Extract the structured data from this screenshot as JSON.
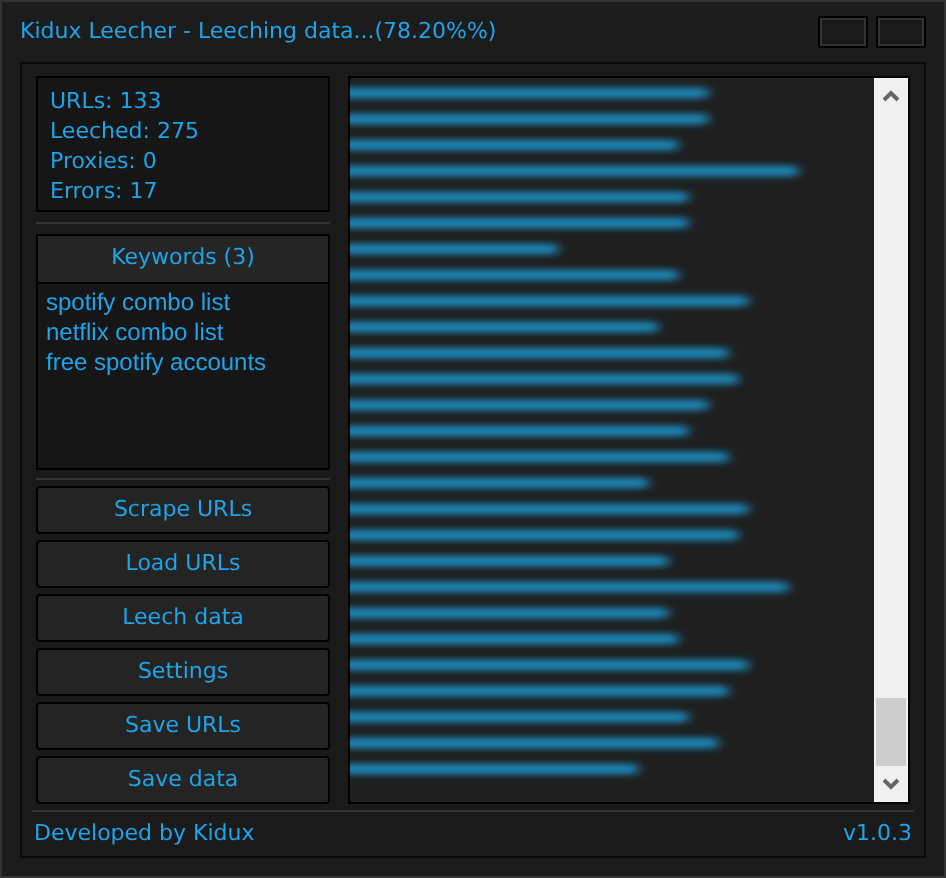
{
  "window": {
    "title": "Kidux Leecher - Leeching data...(78.20%%)"
  },
  "stats": [
    "URLs: 133",
    "Leeched: 275",
    "Proxies: 0",
    "Errors: 17"
  ],
  "keywords": {
    "header": "Keywords (3)",
    "items": [
      "spotify combo list",
      "netflix combo list",
      "free spotify accounts"
    ]
  },
  "buttons": [
    "Scrape URLs",
    "Load URLs",
    "Leech data",
    "Settings",
    "Save URLs",
    "Save data"
  ],
  "footer": {
    "credit": "Developed by Kidux",
    "version": "v1.0.3"
  }
}
